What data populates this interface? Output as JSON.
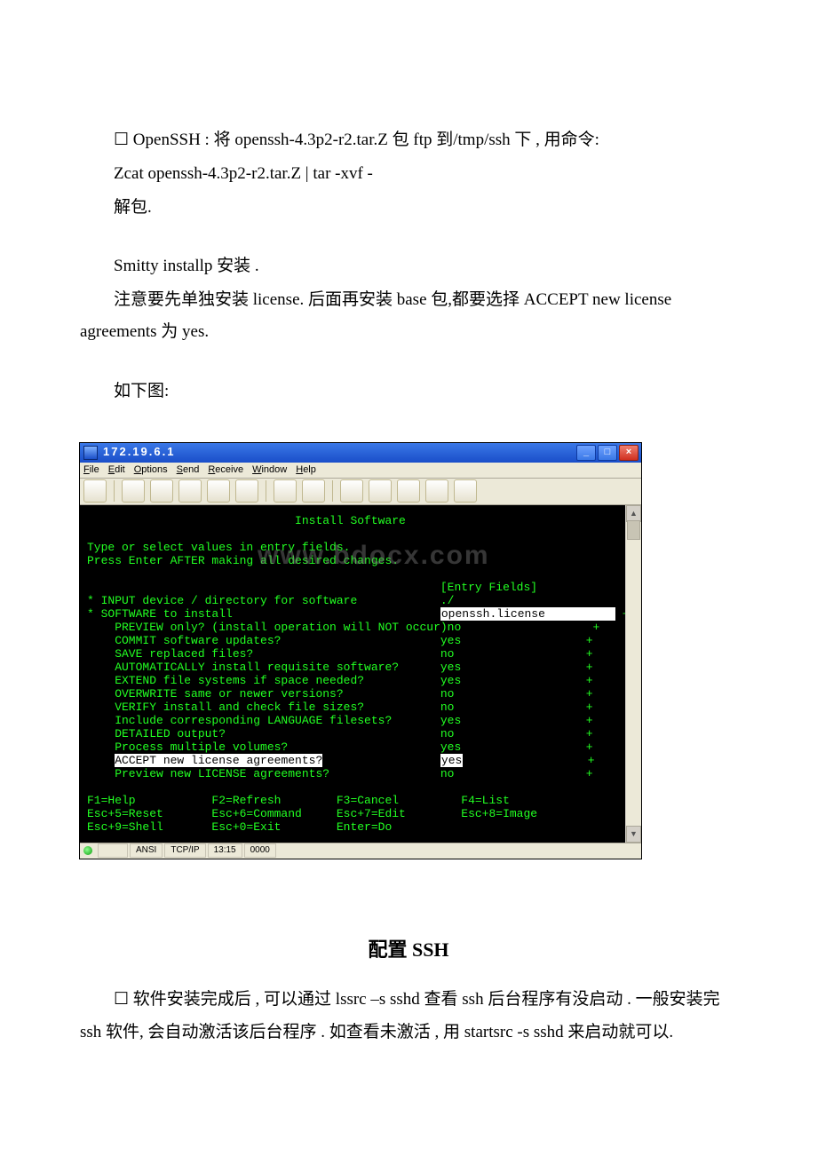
{
  "doc": {
    "p1": "☐ OpenSSH : 将 openssh-4.3p2-r2.tar.Z 包 ftp 到/tmp/ssh 下 , 用命令:",
    "p2": "Zcat openssh-4.3p2-r2.tar.Z | tar -xvf -",
    "p3": "解包.",
    "p4": "Smitty installp 安装 .",
    "p5": "注意要先单独安装 license. 后面再安装 base 包,都要选择 ACCEPT new license agreements 为 yes.",
    "p6": "如下图:",
    "heading": "配置 SSH",
    "p7": "☐ 软件安装完成后 , 可以通过 lssrc –s sshd 查看 ssh 后台程序有没启动 . 一般安装完 ssh 软件, 会自动激活该后台程序 . 如查看未激活 , 用 startsrc -s sshd 来启动就可以."
  },
  "window": {
    "title": "172.19.6.1",
    "menu": [
      "File",
      "Edit",
      "Options",
      "Send",
      "Receive",
      "Window",
      "Help"
    ],
    "watermark": "www.bdocx.com",
    "status": {
      "mode": "ANSI",
      "proto": "TCP/IP",
      "time": "13:15",
      "extra": "0000"
    }
  },
  "term": {
    "title": "Install Software",
    "instr1": "Type or select values in entry fields.",
    "instr2": "Press Enter AFTER making all desired changes.",
    "fields_label": "[Entry Fields]",
    "rows": [
      {
        "star": "*",
        "label": "INPUT device / directory for software",
        "value": "./",
        "plus": false
      },
      {
        "star": "*",
        "label": "SOFTWARE to install",
        "value": "[openssh.license    >",
        "plus": true,
        "hival": true
      },
      {
        "star": " ",
        "label": "  PREVIEW only? (install operation will NOT occur)",
        "value": "no",
        "plus": true
      },
      {
        "star": " ",
        "label": "  COMMIT software updates?",
        "value": "yes",
        "plus": true
      },
      {
        "star": " ",
        "label": "  SAVE replaced files?",
        "value": "no",
        "plus": true
      },
      {
        "star": " ",
        "label": "  AUTOMATICALLY install requisite software?",
        "value": "yes",
        "plus": true
      },
      {
        "star": " ",
        "label": "  EXTEND file systems if space needed?",
        "value": "yes",
        "plus": true
      },
      {
        "star": " ",
        "label": "  OVERWRITE same or newer versions?",
        "value": "no",
        "plus": true
      },
      {
        "star": " ",
        "label": "  VERIFY install and check file sizes?",
        "value": "no",
        "plus": true
      },
      {
        "star": " ",
        "label": "  Include corresponding LANGUAGE filesets?",
        "value": "yes",
        "plus": true
      },
      {
        "star": " ",
        "label": "  DETAILED output?",
        "value": "no",
        "plus": true
      },
      {
        "star": " ",
        "label": "  Process multiple volumes?",
        "value": "yes",
        "plus": true
      },
      {
        "star": " ",
        "label": "  ACCEPT new license agreements?",
        "value": "yes",
        "plus": true,
        "hilbl": true,
        "hival2": true
      },
      {
        "star": " ",
        "label": "  Preview new LICENSE agreements?",
        "value": "no",
        "plus": true
      }
    ],
    "fkeys": [
      [
        "F1=Help",
        "F2=Refresh",
        "F3=Cancel",
        "F4=List"
      ],
      [
        "Esc+5=Reset",
        "Esc+6=Command",
        "Esc+7=Edit",
        "Esc+8=Image"
      ],
      [
        "Esc+9=Shell",
        "Esc+0=Exit",
        "Enter=Do",
        ""
      ]
    ]
  }
}
